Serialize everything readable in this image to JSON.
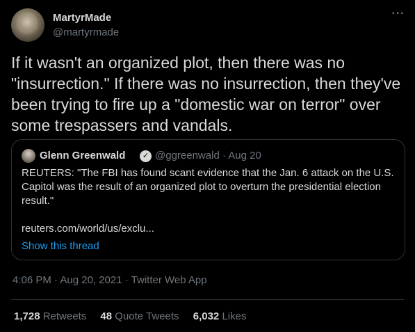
{
  "author": {
    "name": "MartyrMade",
    "handle": "@martyrmade"
  },
  "more_icon": "more-horizontal-icon",
  "tweet_text": "If it wasn't an organized plot, then there was no \"insurrection.\" If there was no insurrection, then they've been trying to fire up a \"domestic war on terror\" over some trespassers and vandals.",
  "quoted": {
    "name": "Glenn Greenwald",
    "verified_icon": "verified-badge-icon",
    "handle_date": "@ggreenwald · Aug 20",
    "text": "REUTERS: \"The FBI has found scant evidence that the Jan. 6 attack on the U.S. Capitol was the result of an organized plot to overturn the presidential election result.\"",
    "link": "reuters.com/world/us/exclu...",
    "show_thread": "Show this thread"
  },
  "meta": "4:06 PM · Aug 20, 2021 · Twitter Web App",
  "stats": [
    {
      "count": "1,728",
      "label": "Retweets"
    },
    {
      "count": "48",
      "label": "Quote Tweets"
    },
    {
      "count": "6,032",
      "label": "Likes"
    }
  ],
  "colors": {
    "background": "#000000",
    "text": "#d9d9d9",
    "secondary": "#6e767d",
    "link": "#1d9bf0",
    "border": "#2f3336"
  }
}
